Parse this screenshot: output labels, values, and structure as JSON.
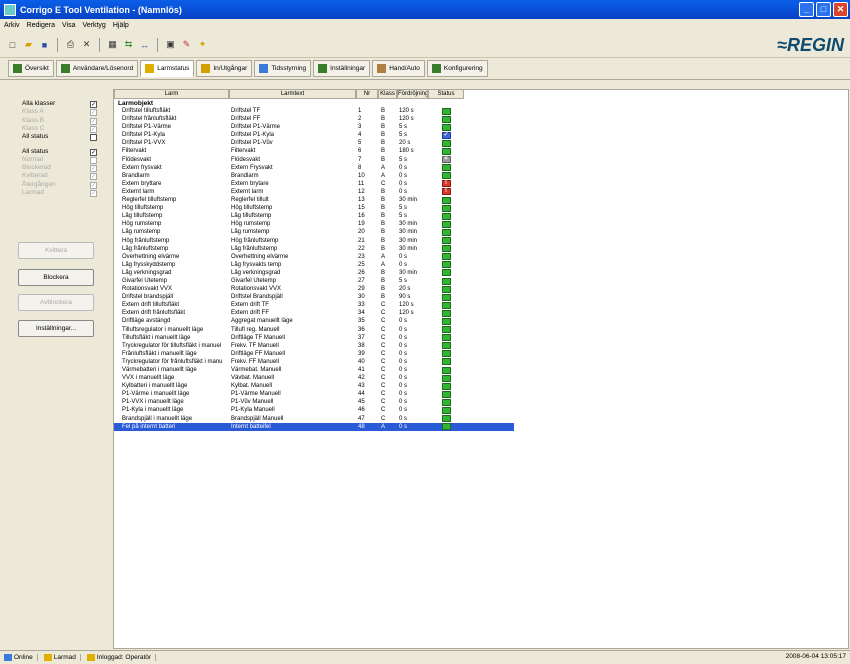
{
  "window": {
    "title": "Corrigo E Tool Ventilation - (Namnlös)"
  },
  "menu": [
    "Arkiv",
    "Redigera",
    "Visa",
    "Verktyg",
    "Hjälp"
  ],
  "toolbar": {
    "icons": [
      "new-icon",
      "open-icon",
      "save-icon",
      "print-icon",
      "delete-icon",
      "calc-icon",
      "connect-icon",
      "transfer-icon",
      "display-icon",
      "edit-icon",
      "wand-icon"
    ]
  },
  "brand": {
    "logo_text": "≈REGIN",
    "color": "#0e4a6e"
  },
  "tabs": [
    {
      "label": "Översikt",
      "icon": "overview-icon",
      "color": "#3a7d2c"
    },
    {
      "label": "Användare/Lösenord",
      "icon": "users-icon",
      "color": "#3a7d2c"
    },
    {
      "label": "Larmstatus",
      "icon": "alarm-icon",
      "color": "#e0b000"
    },
    {
      "label": "In/Utgångar",
      "icon": "io-icon",
      "color": "#d4a000"
    },
    {
      "label": "Tidsstyrning",
      "icon": "calendar-icon",
      "color": "#3b7ad8"
    },
    {
      "label": "Inställningar",
      "icon": "settings-icon",
      "color": "#3a7d2c"
    },
    {
      "label": "Hand/Auto",
      "icon": "hand-icon",
      "color": "#b08040"
    },
    {
      "label": "Konfigurering",
      "icon": "config-icon",
      "color": "#3a7d2c"
    }
  ],
  "active_tab": "Larmstatus",
  "filters": {
    "classes": [
      {
        "label": "Alla klasser",
        "checked": true,
        "enabled": true
      },
      {
        "label": "Klass A",
        "checked": true,
        "enabled": false
      },
      {
        "label": "Klass B",
        "checked": true,
        "enabled": false
      },
      {
        "label": "Klass C",
        "checked": true,
        "enabled": false
      },
      {
        "label": "All status",
        "checked": false,
        "enabled": true
      }
    ],
    "statuses": [
      {
        "label": "All status",
        "checked": true,
        "enabled": true
      },
      {
        "label": "Normal",
        "checked": false,
        "enabled": false
      },
      {
        "label": "Blockerad",
        "checked": true,
        "enabled": false
      },
      {
        "label": "Kvitterad",
        "checked": true,
        "enabled": false
      },
      {
        "label": "Återgången",
        "checked": true,
        "enabled": false
      },
      {
        "label": "Larmad",
        "checked": true,
        "enabled": false
      }
    ]
  },
  "buttons": {
    "kvittera": "Kvittera",
    "blockera": "Blockera",
    "avblockera": "Avblockera",
    "installningar": "Inställningar..."
  },
  "grid": {
    "headers": [
      "Larm",
      "Larmtext",
      "Nr",
      "Klass",
      "Fördröjning",
      "Status"
    ],
    "group": "Larmobjekt",
    "status_colors": {
      "normal": "#2fb52f",
      "check": "#3a66d8",
      "grey": "#999999",
      "red": "#d83a2a"
    },
    "rows": [
      [
        "Driftstel tilluftsfläkt",
        "Driftstel TF",
        "1",
        "B",
        "120 s",
        "normal"
      ],
      [
        "Driftstel frånluftsfläkt",
        "Driftstel FF",
        "2",
        "B",
        "120 s",
        "normal"
      ],
      [
        "Driftstel P1-Värme",
        "Driftstel P1-Värme",
        "3",
        "B",
        "5 s",
        "normal"
      ],
      [
        "Driftstel P1-Kyla",
        "Driftstel P1-Kyla",
        "4",
        "B",
        "5 s",
        "check"
      ],
      [
        "Driftstel P1-VVX",
        "Driftstel P1-Vův",
        "5",
        "B",
        "20 s",
        "normal"
      ],
      [
        "Filtervakt",
        "Filtervakt",
        "6",
        "B",
        "180 s",
        "normal"
      ],
      [
        "Flödesvakt",
        "Flödesvakt",
        "7",
        "B",
        "5 s",
        "grey"
      ],
      [
        "Extern frysvakt",
        "Extern Frysvakt",
        "8",
        "A",
        "0 s",
        "normal"
      ],
      [
        "Brandlarm",
        "Brandlarm",
        "10",
        "A",
        "0 s",
        "normal"
      ],
      [
        "Extern bryttare",
        "Extern brytare",
        "11",
        "C",
        "0 s",
        "red"
      ],
      [
        "Externt larm",
        "Externt larm",
        "12",
        "B",
        "0 s",
        "red"
      ],
      [
        "Reglerfel tilluftstemp",
        "Reglerfel tillult",
        "13",
        "B",
        "30 min",
        "normal"
      ],
      [
        "Hög tilluftstemp",
        "Hög tilluftstemp",
        "15",
        "B",
        "5 s",
        "normal"
      ],
      [
        "Låg tilluftstemp",
        "Låg tilluftstemp",
        "16",
        "B",
        "5 s",
        "normal"
      ],
      [
        "Hög rumstemp",
        "Hög rumstemp",
        "19",
        "B",
        "30 min",
        "normal"
      ],
      [
        "Låg rumstemp",
        "Låg rumstemp",
        "20",
        "B",
        "30 min",
        "normal"
      ],
      [
        "Hög frånluftstemp",
        "Hög frånluftstemp",
        "21",
        "B",
        "30 min",
        "normal"
      ],
      [
        "Låg frånluftstemp",
        "Låg frånluftstemp",
        "22",
        "B",
        "30 min",
        "normal"
      ],
      [
        "Överhettning elvärme",
        "Överhettning elvärme",
        "23",
        "A",
        "0 s",
        "normal"
      ],
      [
        "Låg frysskyddstemp",
        "Låg frysvakts temp",
        "25",
        "A",
        "0 s",
        "normal"
      ],
      [
        "Låg verkningsgrad",
        "Låg verkningsgrad",
        "26",
        "B",
        "30 min",
        "normal"
      ],
      [
        "Givarfel Utetemp",
        "Givarfel Utetemp",
        "27",
        "B",
        "5 s",
        "normal"
      ],
      [
        "Rotationsvakt VVX",
        "Rotationsvakt VVX",
        "29",
        "B",
        "20 s",
        "normal"
      ],
      [
        "Driftstel brandspjäll",
        "Driftstel Brandspjäll",
        "30",
        "B",
        "90 s",
        "normal"
      ],
      [
        "Extern drift tilluftsfläkt",
        "Extern drift TF",
        "33",
        "C",
        "120 s",
        "normal"
      ],
      [
        "Extern drift frånluftsfläkt",
        "Extern drift FF",
        "34",
        "C",
        "120 s",
        "normal"
      ],
      [
        "Driftläge avstängd",
        "Aggregat manuellt läge",
        "35",
        "C",
        "0 s",
        "normal"
      ],
      [
        "Tilluftsregulator i manuellt läge",
        "Tillufl reg. Manuell",
        "36",
        "C",
        "0 s",
        "normal"
      ],
      [
        "Tilluftsfläkt i manuellt läge",
        "Driftläge TF Manuell",
        "37",
        "C",
        "0 s",
        "normal"
      ],
      [
        "Tryckregulator för tilluftsfläkt i manuel",
        "Frekv. TF Manuell",
        "38",
        "C",
        "0 s",
        "normal"
      ],
      [
        "Frånluftsfläkt i manuellt läge",
        "Driftläge FF Manuell",
        "39",
        "C",
        "0 s",
        "normal"
      ],
      [
        "Tryckregulator för frånluftsfläkt i manu",
        "Frekv. FF Manuell",
        "40",
        "C",
        "0 s",
        "normal"
      ],
      [
        "Värmebatteri i manuellt läge",
        "Värmebat. Manuell",
        "41",
        "C",
        "0 s",
        "normal"
      ],
      [
        "VVX i manuellt läge",
        "Vävbat. Manuell",
        "42",
        "C",
        "0 s",
        "normal"
      ],
      [
        "Kylbatteri i manuellt läge",
        "Kylbat. Manuell",
        "43",
        "C",
        "0 s",
        "normal"
      ],
      [
        "P1-Värme i manuellt läge",
        "P1-Värme Manuell",
        "44",
        "C",
        "0 s",
        "normal"
      ],
      [
        "P1-VVX i manuellt läge",
        "P1-Vův Manuell",
        "45",
        "C",
        "0 s",
        "normal"
      ],
      [
        "P1-Kyla i manuellt läge",
        "P1-Kyla Manuell",
        "46",
        "C",
        "0 s",
        "normal"
      ],
      [
        "Brandspjäll i manuellt läge",
        "Brandspjäll Manuell",
        "47",
        "C",
        "0 s",
        "normal"
      ],
      [
        "Fel på internt batteri",
        "Internt batteifel",
        "48",
        "A",
        "0 s",
        "normal"
      ]
    ],
    "selected_row": 39
  },
  "statusbar": {
    "items": [
      {
        "label": "Online",
        "icon": "online-icon"
      },
      {
        "label": "Larmad",
        "icon": "alarm-icon"
      },
      {
        "label": "Inloggad: Operatör",
        "icon": "user-icon"
      }
    ],
    "clock": "2008-06-04 13:05:17"
  }
}
